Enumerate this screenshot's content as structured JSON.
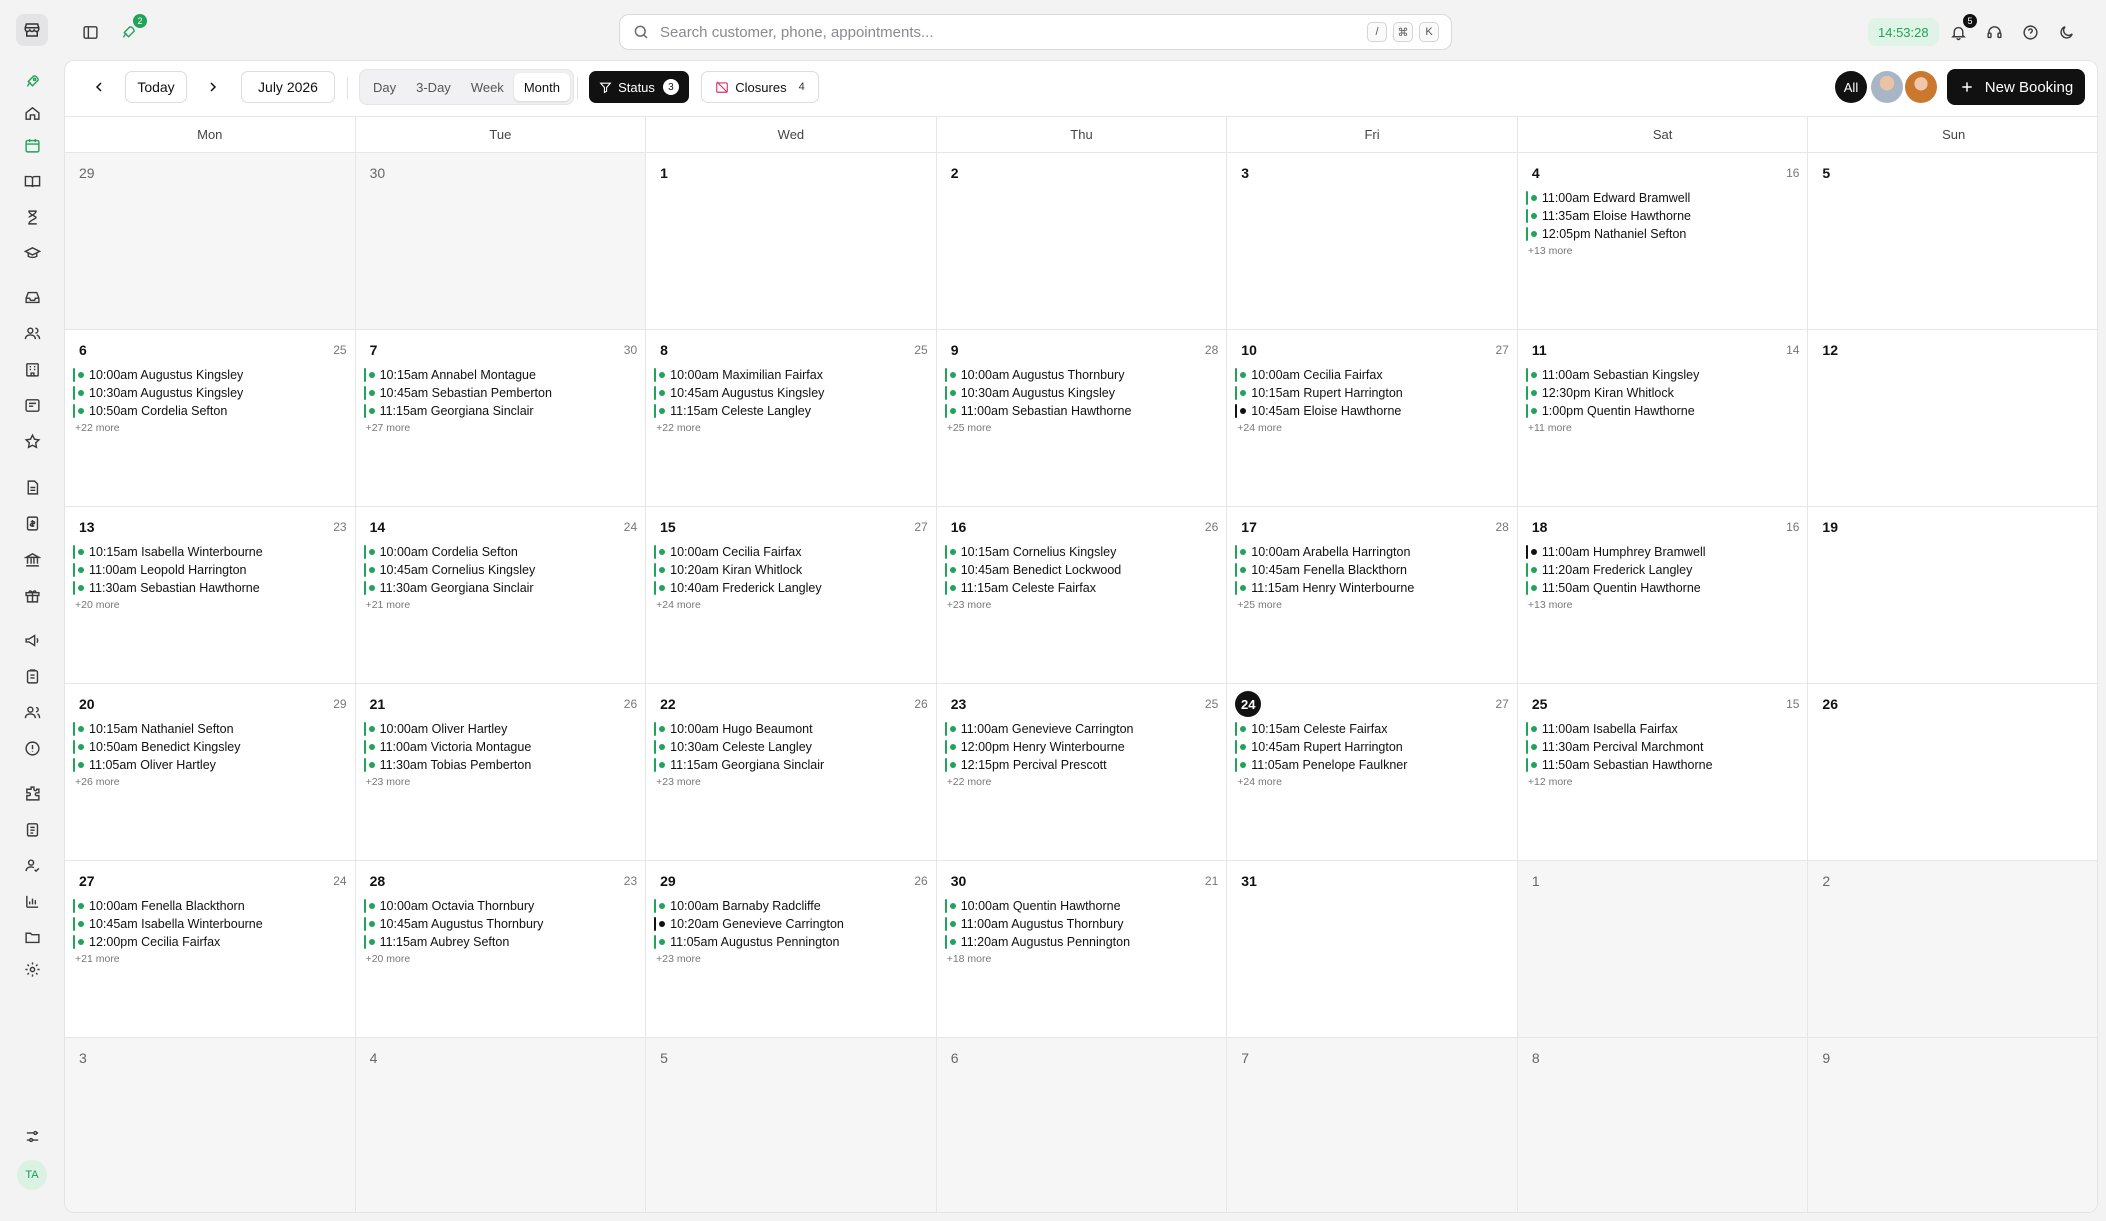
{
  "app": {
    "rail_avatar": "TA",
    "rocket_badge": "2",
    "notifications_badge": "5",
    "clock": "14:53:28"
  },
  "search": {
    "placeholder": "Search customer, phone, appointments...",
    "shortcut_slash": "/",
    "shortcut_cmd": "⌘",
    "shortcut_k": "K"
  },
  "toolbar": {
    "today_label": "Today",
    "month_label": "July 2026",
    "views": [
      "Day",
      "3-Day",
      "Week",
      "Month"
    ],
    "active_view": "Month",
    "status_label": "Status",
    "status_count": "3",
    "closures_label": "Closures",
    "closures_count": "4",
    "all_label": "All",
    "new_booking_label": "New Booking"
  },
  "colors": {
    "accent": "#22a35a",
    "dark": "#111111"
  },
  "calendar": {
    "weekdays": [
      "Mon",
      "Tue",
      "Wed",
      "Thu",
      "Fri",
      "Sat",
      "Sun"
    ],
    "today": "24",
    "weeks": [
      [
        {
          "day": "29",
          "outside": true
        },
        {
          "day": "30",
          "outside": true
        },
        {
          "day": "1"
        },
        {
          "day": "2"
        },
        {
          "day": "3"
        },
        {
          "day": "4",
          "count": "16",
          "events": [
            {
              "t": "11:00am Edward Bramwell"
            },
            {
              "t": "11:35am Eloise Hawthorne"
            },
            {
              "t": "12:05pm Nathaniel Sefton"
            }
          ],
          "more": "+13 more"
        },
        {
          "day": "5"
        }
      ],
      [
        {
          "day": "6",
          "count": "25",
          "events": [
            {
              "t": "10:00am Augustus Kingsley"
            },
            {
              "t": "10:30am Augustus Kingsley"
            },
            {
              "t": "10:50am Cordelia Sefton"
            }
          ],
          "more": "+22 more"
        },
        {
          "day": "7",
          "count": "30",
          "events": [
            {
              "t": "10:15am Annabel Montague"
            },
            {
              "t": "10:45am Sebastian Pemberton"
            },
            {
              "t": "11:15am Georgiana Sinclair"
            }
          ],
          "more": "+27 more"
        },
        {
          "day": "8",
          "count": "25",
          "events": [
            {
              "t": "10:00am Maximilian Fairfax"
            },
            {
              "t": "10:45am Augustus Kingsley"
            },
            {
              "t": "11:15am Celeste Langley"
            }
          ],
          "more": "+22 more"
        },
        {
          "day": "9",
          "count": "28",
          "events": [
            {
              "t": "10:00am Augustus Thornbury"
            },
            {
              "t": "10:30am Augustus Kingsley"
            },
            {
              "t": "11:00am Sebastian Hawthorne"
            }
          ],
          "more": "+25 more"
        },
        {
          "day": "10",
          "count": "27",
          "events": [
            {
              "t": "10:00am Cecilia Fairfax"
            },
            {
              "t": "10:15am Rupert Harrington"
            },
            {
              "t": "10:45am Eloise Hawthorne",
              "dark": true
            }
          ],
          "more": "+24 more"
        },
        {
          "day": "11",
          "count": "14",
          "events": [
            {
              "t": "11:00am Sebastian Kingsley"
            },
            {
              "t": "12:30pm Kiran Whitlock"
            },
            {
              "t": "1:00pm Quentin Hawthorne"
            }
          ],
          "more": "+11 more"
        },
        {
          "day": "12"
        }
      ],
      [
        {
          "day": "13",
          "count": "23",
          "events": [
            {
              "t": "10:15am Isabella Winterbourne"
            },
            {
              "t": "11:00am Leopold Harrington"
            },
            {
              "t": "11:30am Sebastian Hawthorne"
            }
          ],
          "more": "+20 more"
        },
        {
          "day": "14",
          "count": "24",
          "events": [
            {
              "t": "10:00am Cordelia Sefton"
            },
            {
              "t": "10:45am Cornelius Kingsley"
            },
            {
              "t": "11:30am Georgiana Sinclair"
            }
          ],
          "more": "+21 more"
        },
        {
          "day": "15",
          "count": "27",
          "events": [
            {
              "t": "10:00am Cecilia Fairfax"
            },
            {
              "t": "10:20am Kiran Whitlock"
            },
            {
              "t": "10:40am Frederick Langley"
            }
          ],
          "more": "+24 more"
        },
        {
          "day": "16",
          "count": "26",
          "events": [
            {
              "t": "10:15am Cornelius Kingsley"
            },
            {
              "t": "10:45am Benedict Lockwood"
            },
            {
              "t": "11:15am Celeste Fairfax"
            }
          ],
          "more": "+23 more"
        },
        {
          "day": "17",
          "count": "28",
          "events": [
            {
              "t": "10:00am Arabella Harrington"
            },
            {
              "t": "10:45am Fenella Blackthorn"
            },
            {
              "t": "11:15am Henry Winterbourne"
            }
          ],
          "more": "+25 more"
        },
        {
          "day": "18",
          "count": "16",
          "events": [
            {
              "t": "11:00am Humphrey Bramwell",
              "dark": true
            },
            {
              "t": "11:20am Frederick Langley"
            },
            {
              "t": "11:50am Quentin Hawthorne"
            }
          ],
          "more": "+13 more"
        },
        {
          "day": "19"
        }
      ],
      [
        {
          "day": "20",
          "count": "29",
          "events": [
            {
              "t": "10:15am Nathaniel Sefton"
            },
            {
              "t": "10:50am Benedict Kingsley"
            },
            {
              "t": "11:05am Oliver Hartley"
            }
          ],
          "more": "+26 more"
        },
        {
          "day": "21",
          "count": "26",
          "events": [
            {
              "t": "10:00am Oliver Hartley"
            },
            {
              "t": "11:00am Victoria Montague"
            },
            {
              "t": "11:30am Tobias Pemberton"
            }
          ],
          "more": "+23 more"
        },
        {
          "day": "22",
          "count": "26",
          "events": [
            {
              "t": "10:00am Hugo Beaumont"
            },
            {
              "t": "10:30am Celeste Langley"
            },
            {
              "t": "11:15am Georgiana Sinclair"
            }
          ],
          "more": "+23 more"
        },
        {
          "day": "23",
          "count": "25",
          "events": [
            {
              "t": "11:00am Genevieve Carrington"
            },
            {
              "t": "12:00pm Henry Winterbourne"
            },
            {
              "t": "12:15pm Percival Prescott"
            }
          ],
          "more": "+22 more"
        },
        {
          "day": "24",
          "count": "27",
          "today": true,
          "events": [
            {
              "t": "10:15am Celeste Fairfax"
            },
            {
              "t": "10:45am Rupert Harrington"
            },
            {
              "t": "11:05am Penelope Faulkner"
            }
          ],
          "more": "+24 more"
        },
        {
          "day": "25",
          "count": "15",
          "events": [
            {
              "t": "11:00am Isabella Fairfax"
            },
            {
              "t": "11:30am Percival Marchmont"
            },
            {
              "t": "11:50am Sebastian Hawthorne"
            }
          ],
          "more": "+12 more"
        },
        {
          "day": "26"
        }
      ],
      [
        {
          "day": "27",
          "count": "24",
          "events": [
            {
              "t": "10:00am Fenella Blackthorn"
            },
            {
              "t": "10:45am Isabella Winterbourne"
            },
            {
              "t": "12:00pm Cecilia Fairfax"
            }
          ],
          "more": "+21 more"
        },
        {
          "day": "28",
          "count": "23",
          "events": [
            {
              "t": "10:00am Octavia Thornbury"
            },
            {
              "t": "10:45am Augustus Thornbury"
            },
            {
              "t": "11:15am Aubrey Sefton"
            }
          ],
          "more": "+20 more"
        },
        {
          "day": "29",
          "count": "26",
          "events": [
            {
              "t": "10:00am Barnaby Radcliffe"
            },
            {
              "t": "10:20am Genevieve Carrington",
              "dark": true
            },
            {
              "t": "11:05am Augustus Pennington"
            }
          ],
          "more": "+23 more"
        },
        {
          "day": "30",
          "count": "21",
          "events": [
            {
              "t": "10:00am Quentin Hawthorne"
            },
            {
              "t": "11:00am Augustus Thornbury"
            },
            {
              "t": "11:20am Augustus Pennington"
            }
          ],
          "more": "+18 more"
        },
        {
          "day": "31"
        },
        {
          "day": "1",
          "outside": true
        },
        {
          "day": "2",
          "outside": true
        }
      ],
      [
        {
          "day": "3",
          "outside": true
        },
        {
          "day": "4",
          "outside": true
        },
        {
          "day": "5",
          "outside": true
        },
        {
          "day": "6",
          "outside": true
        },
        {
          "day": "7",
          "outside": true
        },
        {
          "day": "8",
          "outside": true
        },
        {
          "day": "9",
          "outside": true
        }
      ]
    ]
  }
}
